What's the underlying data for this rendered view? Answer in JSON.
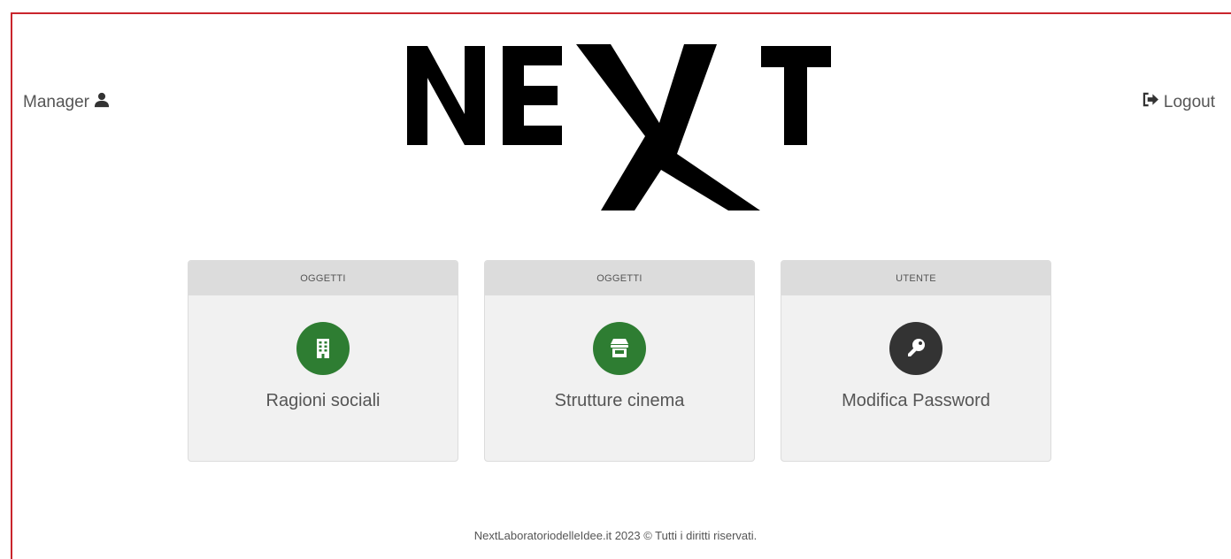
{
  "header": {
    "user_label": "Manager",
    "user_icon": "user-icon",
    "logout_label": "Logout",
    "logout_icon": "sign-out-icon",
    "logo_text": "NEXT"
  },
  "cards": [
    {
      "category": "OGGETTI",
      "title": "Ragioni sociali",
      "icon": "building-icon",
      "icon_color": "#2e7d32"
    },
    {
      "category": "OGGETTI",
      "title": "Strutture cinema",
      "icon": "store-icon",
      "icon_color": "#2e7d32"
    },
    {
      "category": "UTENTE",
      "title": "Modifica Password",
      "icon": "key-icon",
      "icon_color": "#333333"
    }
  ],
  "footer": {
    "text": "NextLaboratoriodelleIdee.it 2023 © Tutti i diritti riservati."
  },
  "colors": {
    "accent_border": "#c9252c",
    "card_background": "#f1f1f1",
    "card_header": "#dcdcdc"
  }
}
